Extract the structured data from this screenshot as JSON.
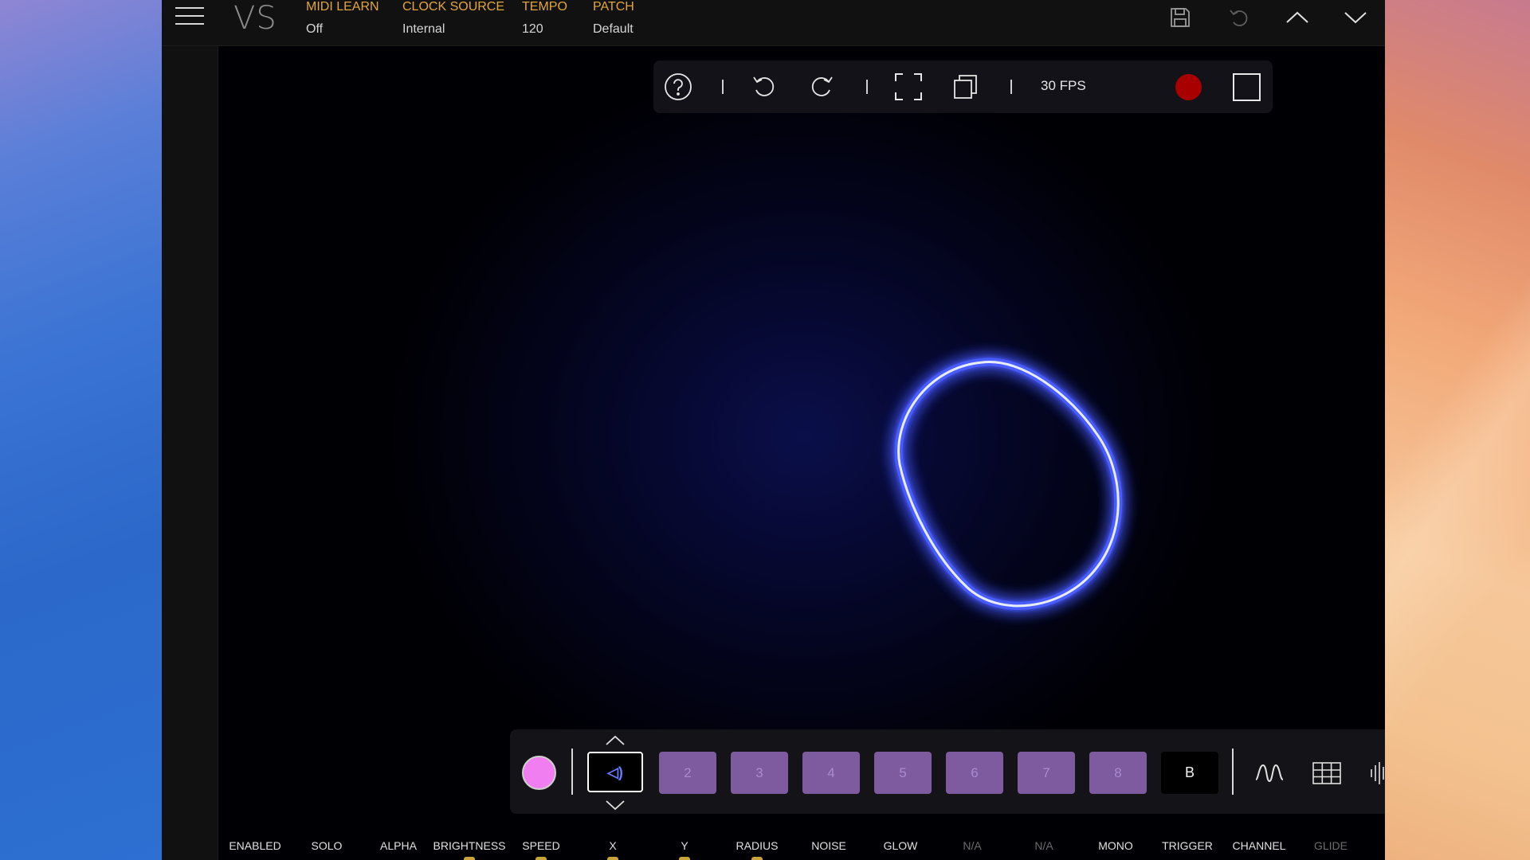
{
  "app": {
    "logo": "VS"
  },
  "header": {
    "fields": [
      {
        "label": "MIDI LEARN",
        "value": "Off"
      },
      {
        "label": "CLOCK SOURCE",
        "value": "Internal"
      },
      {
        "label": "TEMPO",
        "value": "120"
      },
      {
        "label": "PATCH",
        "value": "Default"
      }
    ],
    "icons": [
      "save-icon",
      "undo-icon",
      "chevron-up-icon",
      "chevron-down-icon"
    ]
  },
  "toolbar": {
    "icons": [
      "help-icon",
      "undo-icon",
      "redo-icon",
      "fullscreen-icon",
      "duplicate-icon"
    ],
    "fps": "30 FPS",
    "record_color": "#a80000"
  },
  "slots": {
    "active_color": "#6a7bff",
    "items": [
      "2",
      "3",
      "4",
      "5",
      "6",
      "7",
      "8"
    ],
    "bus_label": "B",
    "slot_color": "#7e5a9e",
    "swatch_color": "#f07ef0",
    "icons": [
      "waveform-icon",
      "grid-icon",
      "audio-bars-icon"
    ]
  },
  "params": [
    {
      "label": "ENABLED"
    },
    {
      "label": "SOLO"
    },
    {
      "label": "ALPHA"
    },
    {
      "label": "BRIGHTNESS"
    },
    {
      "label": "SPEED"
    },
    {
      "label": "X"
    },
    {
      "label": "Y"
    },
    {
      "label": "RADIUS"
    },
    {
      "label": "NOISE"
    },
    {
      "label": "GLOW"
    },
    {
      "label": "N/A"
    },
    {
      "label": "N/A"
    },
    {
      "label": "MONO"
    },
    {
      "label": "TRIGGER"
    },
    {
      "label": "CHANNEL"
    },
    {
      "label": "GLIDE"
    }
  ],
  "colors": {
    "accent": "#e3a63a",
    "ring": "#4b5bff",
    "background": "#000004"
  }
}
